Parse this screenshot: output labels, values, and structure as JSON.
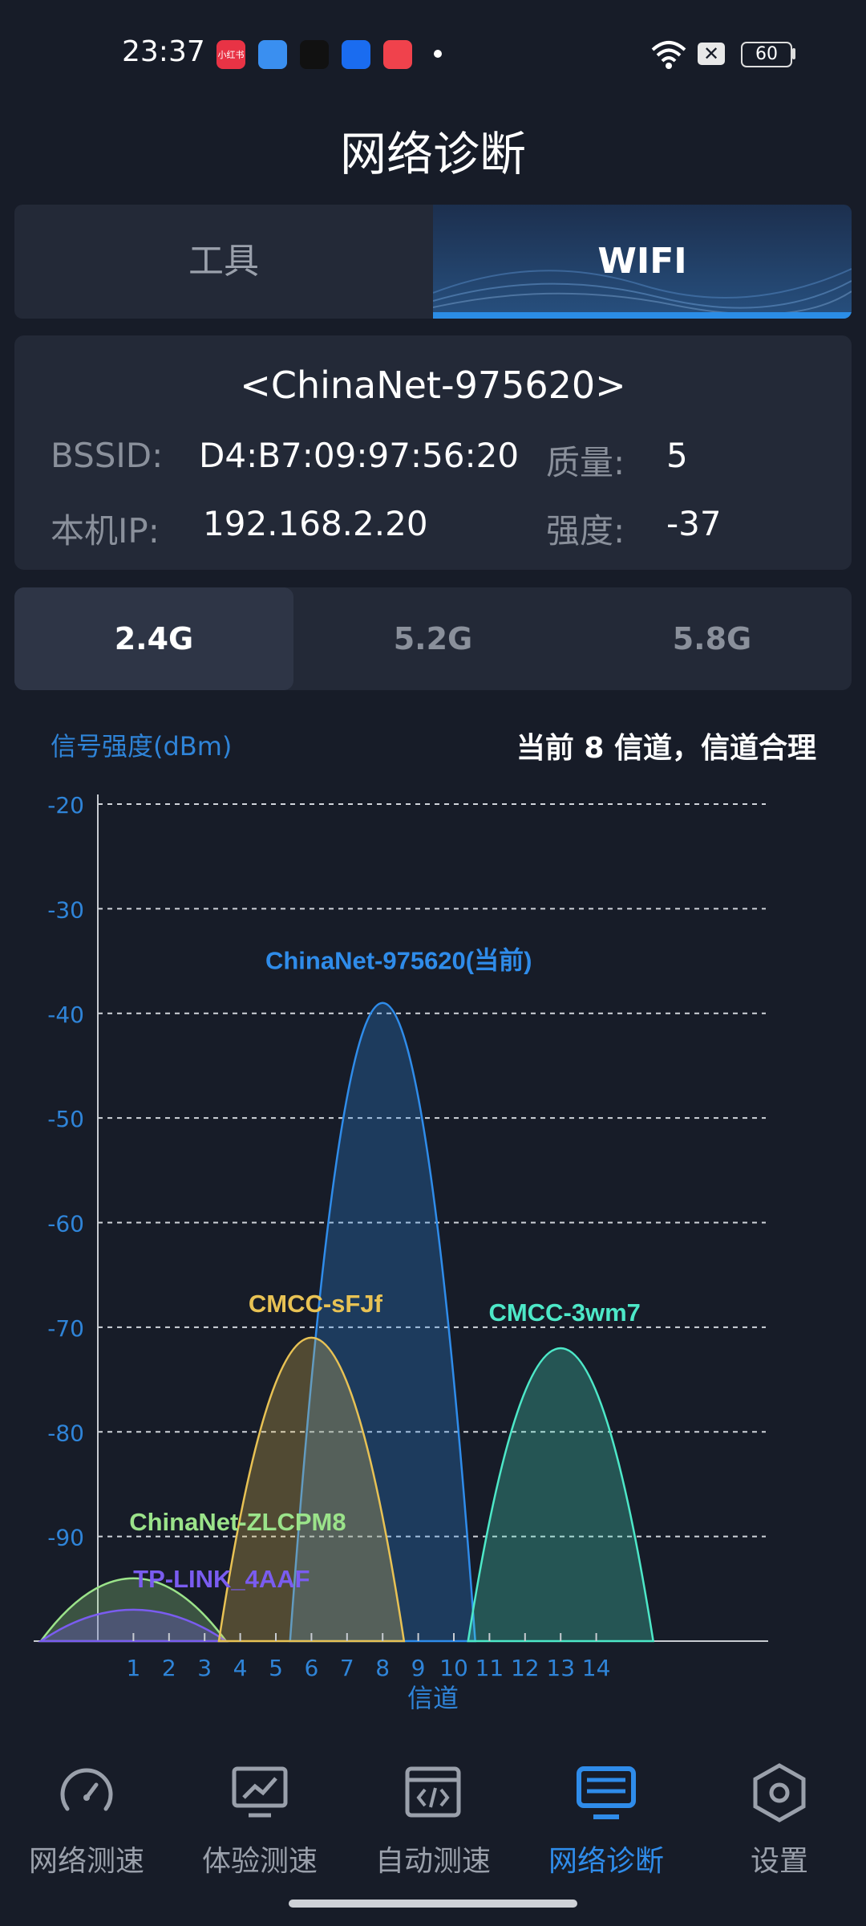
{
  "status_bar": {
    "time": "23:37",
    "battery": "60",
    "app_icons": [
      {
        "name": "xiaohongshu-icon",
        "color": "#e83345",
        "text": "小红书"
      },
      {
        "name": "cloud-app-icon",
        "color": "#3a8ff0",
        "text": ""
      },
      {
        "name": "paper-plane-app-icon",
        "color": "#111111",
        "text": ""
      },
      {
        "name": "shield-app-icon",
        "color": "#1a6cf0",
        "text": ""
      },
      {
        "name": "music-app-icon",
        "color": "#f0424c",
        "text": ""
      }
    ]
  },
  "page": {
    "title": "网络诊断"
  },
  "tabs": {
    "tools": "工具",
    "wifi": "WIFI",
    "active": "wifi"
  },
  "network": {
    "ssid": "<ChinaNet-975620>",
    "bssid_label": "BSSID:",
    "bssid": "D4:B7:09:97:56:20",
    "quality_label": "质量:",
    "quality": "5",
    "ip_label": "本机IP:",
    "ip": "192.168.2.20",
    "strength_label": "强度:",
    "strength": "-37"
  },
  "bands": {
    "items": [
      "2.4G",
      "5.2G",
      "5.8G"
    ],
    "active": "2.4G"
  },
  "chart_header": {
    "y_title": "信号强度(dBm)",
    "channel_status": "当前 8 信道，信道合理"
  },
  "chart_data": {
    "type": "area",
    "xlabel": "信道",
    "ylabel": "信号强度(dBm)",
    "x_ticks": [
      1,
      2,
      3,
      4,
      5,
      6,
      7,
      8,
      9,
      10,
      11,
      12,
      13,
      14
    ],
    "y_ticks": [
      -20,
      -30,
      -40,
      -50,
      -60,
      -70,
      -80,
      -90
    ],
    "ylim": [
      -100,
      -20
    ],
    "grid": "horizontal-dashed",
    "series": [
      {
        "name": "ChinaNet-975620(当前)",
        "channel": 8,
        "level": -39,
        "color": "#2f8cea"
      },
      {
        "name": "CMCC-sFJf",
        "channel": 6,
        "level": -71,
        "color": "#e8c254"
      },
      {
        "name": "CMCC-3wm7",
        "channel": 13,
        "level": -72,
        "color": "#4de8c8"
      },
      {
        "name": "ChinaNet-ZLCPM8",
        "channel": 1,
        "level": -94,
        "color": "#9be38a"
      },
      {
        "name": "TP-LINK_4AAF",
        "channel": 1,
        "level": -97,
        "color": "#7a5cf0"
      }
    ]
  },
  "nav": {
    "items": [
      {
        "label": "网络测速",
        "icon": "speedometer-icon"
      },
      {
        "label": "体验测速",
        "icon": "monitor-chart-icon"
      },
      {
        "label": "自动测速",
        "icon": "code-window-icon"
      },
      {
        "label": "网络诊断",
        "icon": "desktop-icon"
      },
      {
        "label": "设置",
        "icon": "hexagon-settings-icon"
      }
    ],
    "active": 3,
    "active_color": "#2f8cea",
    "inactive_color": "#9aa0ab"
  }
}
